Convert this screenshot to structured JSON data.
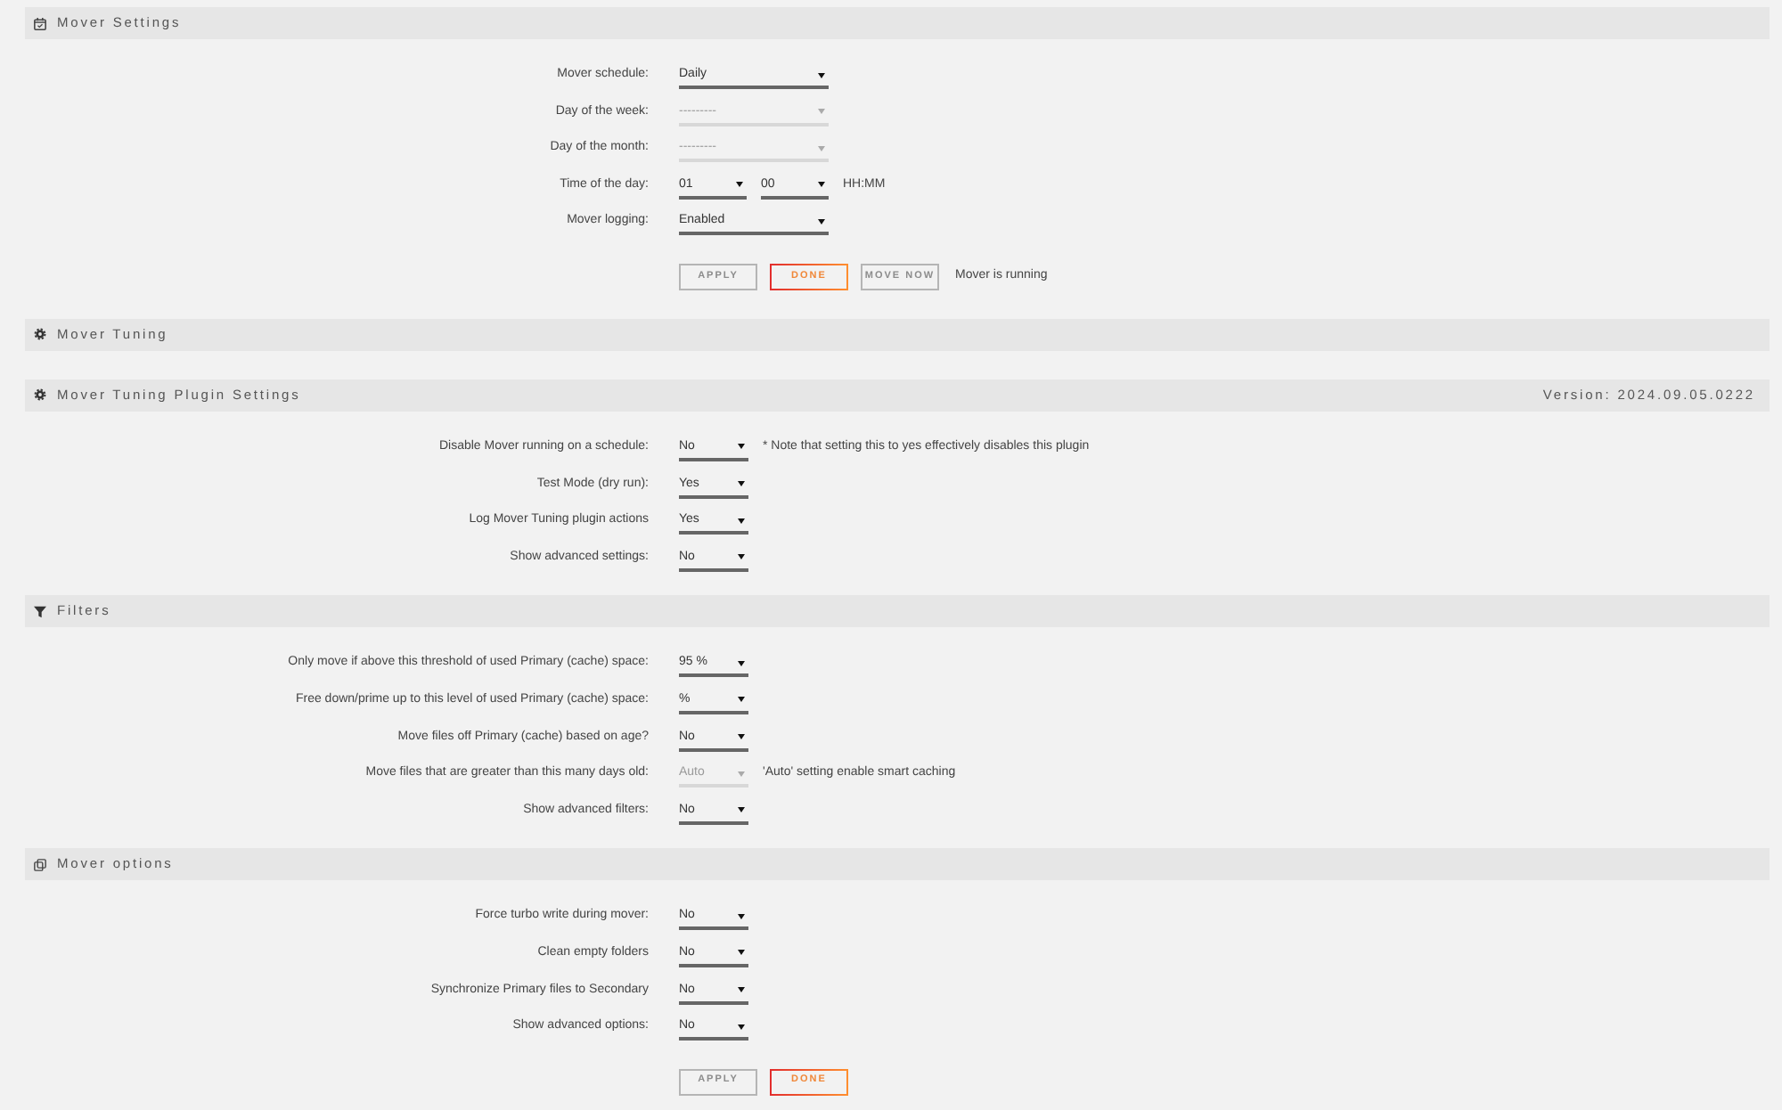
{
  "sections": [
    {
      "title": "Mover Settings",
      "rows": [
        {
          "label": "Mover schedule:",
          "fields": [
            {
              "value": "Daily",
              "disabled": false
            }
          ]
        },
        {
          "label": "Day of the week:",
          "fields": [
            {
              "value": "---------",
              "disabled": true
            }
          ]
        },
        {
          "label": "Day of the month:",
          "fields": [
            {
              "value": "---------",
              "disabled": true
            }
          ]
        },
        {
          "label": "Time of the day:",
          "fields": [
            {
              "value": "01",
              "disabled": false
            },
            {
              "value": "00",
              "disabled": false
            }
          ],
          "note": "HH:MM"
        },
        {
          "label": "Mover logging:",
          "fields": [
            {
              "value": "Enabled",
              "disabled": false
            }
          ]
        }
      ],
      "buttons": [
        {
          "label": "APPLY",
          "disabled": true
        },
        {
          "label": "DONE",
          "disabled": false
        },
        {
          "label": "MOVE NOW",
          "disabled": true
        }
      ],
      "status": "Mover is running"
    },
    {
      "title": "Mover Tuning"
    },
    {
      "title": "Mover Tuning Plugin Settings",
      "version": "Version: 2024.09.05.0222",
      "rows": [
        {
          "label": "Disable Mover running on a schedule:",
          "fields": [
            {
              "value": "No",
              "disabled": false
            }
          ],
          "note": "* Note that setting this to yes effectively disables this plugin"
        },
        {
          "label": "Test Mode (dry run):",
          "fields": [
            {
              "value": "Yes",
              "disabled": false
            }
          ]
        },
        {
          "label": "Log Mover Tuning plugin actions",
          "fields": [
            {
              "value": "Yes",
              "disabled": false
            }
          ]
        },
        {
          "label": "Show advanced settings:",
          "fields": [
            {
              "value": "No",
              "disabled": false
            }
          ]
        }
      ]
    },
    {
      "title": "Filters",
      "rows": [
        {
          "label": "Only move if above this threshold of used Primary (cache) space:",
          "fields": [
            {
              "value": "95 %",
              "disabled": false
            }
          ]
        },
        {
          "label": "Free down/prime up to this level of used Primary (cache) space:",
          "fields": [
            {
              "value": "%",
              "disabled": false
            }
          ]
        },
        {
          "label": "Move files off Primary (cache) based on age?",
          "fields": [
            {
              "value": "No",
              "disabled": false
            }
          ]
        },
        {
          "label": "Move files that are greater than this many days old:",
          "fields": [
            {
              "value": "Auto",
              "disabled": true
            }
          ],
          "note": "'Auto' setting enable smart caching"
        },
        {
          "label": "Show advanced filters:",
          "fields": [
            {
              "value": "No",
              "disabled": false
            }
          ]
        }
      ]
    },
    {
      "title": "Mover options",
      "rows": [
        {
          "label": "Force turbo write during mover:",
          "fields": [
            {
              "value": "No",
              "disabled": false
            }
          ]
        },
        {
          "label": "Clean empty folders",
          "fields": [
            {
              "value": "No",
              "disabled": false
            }
          ]
        },
        {
          "label": "Synchronize Primary files to Secondary",
          "fields": [
            {
              "value": "No",
              "disabled": false
            }
          ]
        },
        {
          "label": "Show advanced options:",
          "fields": [
            {
              "value": "No",
              "disabled": false
            }
          ]
        }
      ],
      "buttons": [
        {
          "label": "APPLY",
          "disabled": true
        },
        {
          "label": "DONE",
          "disabled": false
        }
      ]
    }
  ]
}
